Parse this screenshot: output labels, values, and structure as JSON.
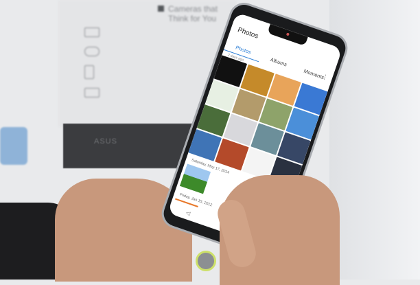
{
  "background_sign": {
    "title": "Cameras that Think for You",
    "brand": "ASUS"
  },
  "phone": {
    "app_title": "Photos",
    "tabs": [
      {
        "label": "Photos",
        "active": true
      },
      {
        "label": "Albums",
        "active": false
      },
      {
        "label": "Moments",
        "active": false
      }
    ],
    "more_icon": "⋮",
    "group_label": "2 days ago",
    "dates": [
      "Saturday, May 17, 2014",
      "Friday, Jan 15, 2012"
    ],
    "nav_icons": [
      "◁",
      "⌂"
    ],
    "fab_icon": "⌃",
    "accent": "#2c7fd6",
    "thumbnails": [
      "#111111",
      "#c58a2a",
      "#e8a45a",
      "#3a79d4",
      "#e7f0e3",
      "#b39b6b",
      "#8ea36a",
      "#4b8fd9",
      "#4a6d3a",
      "#d8d8dc",
      "#6c8f9a",
      "#374766",
      "#3f74b6",
      "#b44a2a",
      "#f4f4f4",
      "#2a3140"
    ]
  }
}
